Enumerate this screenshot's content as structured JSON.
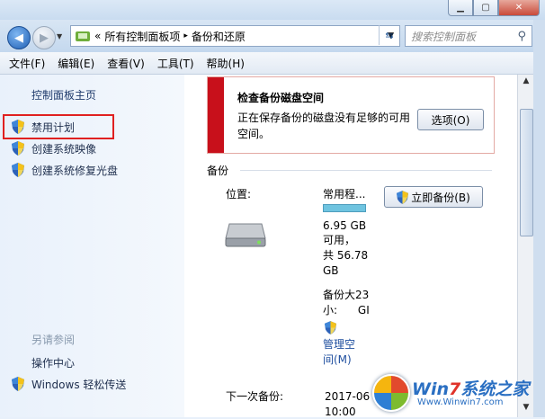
{
  "window": {
    "buttons": {
      "minimize": "▁",
      "maximize": "▢",
      "close": "✕"
    }
  },
  "address_bar": {
    "overflow": "«",
    "crumbs": [
      "所有控制面板项",
      "备份和还原"
    ],
    "separator": "▸"
  },
  "search": {
    "placeholder": "搜索控制面板"
  },
  "menu": [
    "文件(F)",
    "编辑(E)",
    "查看(V)",
    "工具(T)",
    "帮助(H)"
  ],
  "sidebar": {
    "home": "控制面板主页",
    "items": [
      "禁用计划",
      "创建系统映像",
      "创建系统修复光盘"
    ],
    "see_also_title": "另请参阅",
    "see_also": [
      "操作中心",
      "Windows 轻松传送"
    ]
  },
  "alert": {
    "title": "检查备份磁盘空间",
    "message": "正在保存备份的磁盘没有足够的可用空间。",
    "options_button": "选项(O)"
  },
  "backup": {
    "section_title": "备份",
    "location_label": "位置:",
    "location_value": "常用程...",
    "backup_now_button": "立即备份(B)",
    "free_line1": "6.95 GB",
    "free_line2": "可用，",
    "free_line3": "共 56.78",
    "free_line4": "GB",
    "size_line1": "备份大23",
    "size_line2": "小:      GI",
    "manage_line1": "管理空",
    "manage_line2": "间(M)",
    "next_label": "下一次备份:",
    "next_value": "2017-06",
    "next_value2": "10:00"
  },
  "watermark": {
    "brand_a": "Win",
    "brand_b": "7",
    "brand_c": "系统之家",
    "url": "Www.Winwin7.com"
  },
  "colors": {
    "alert_red": "#c8101b",
    "highlight": "#e02020",
    "link": "#1f4f9f"
  }
}
